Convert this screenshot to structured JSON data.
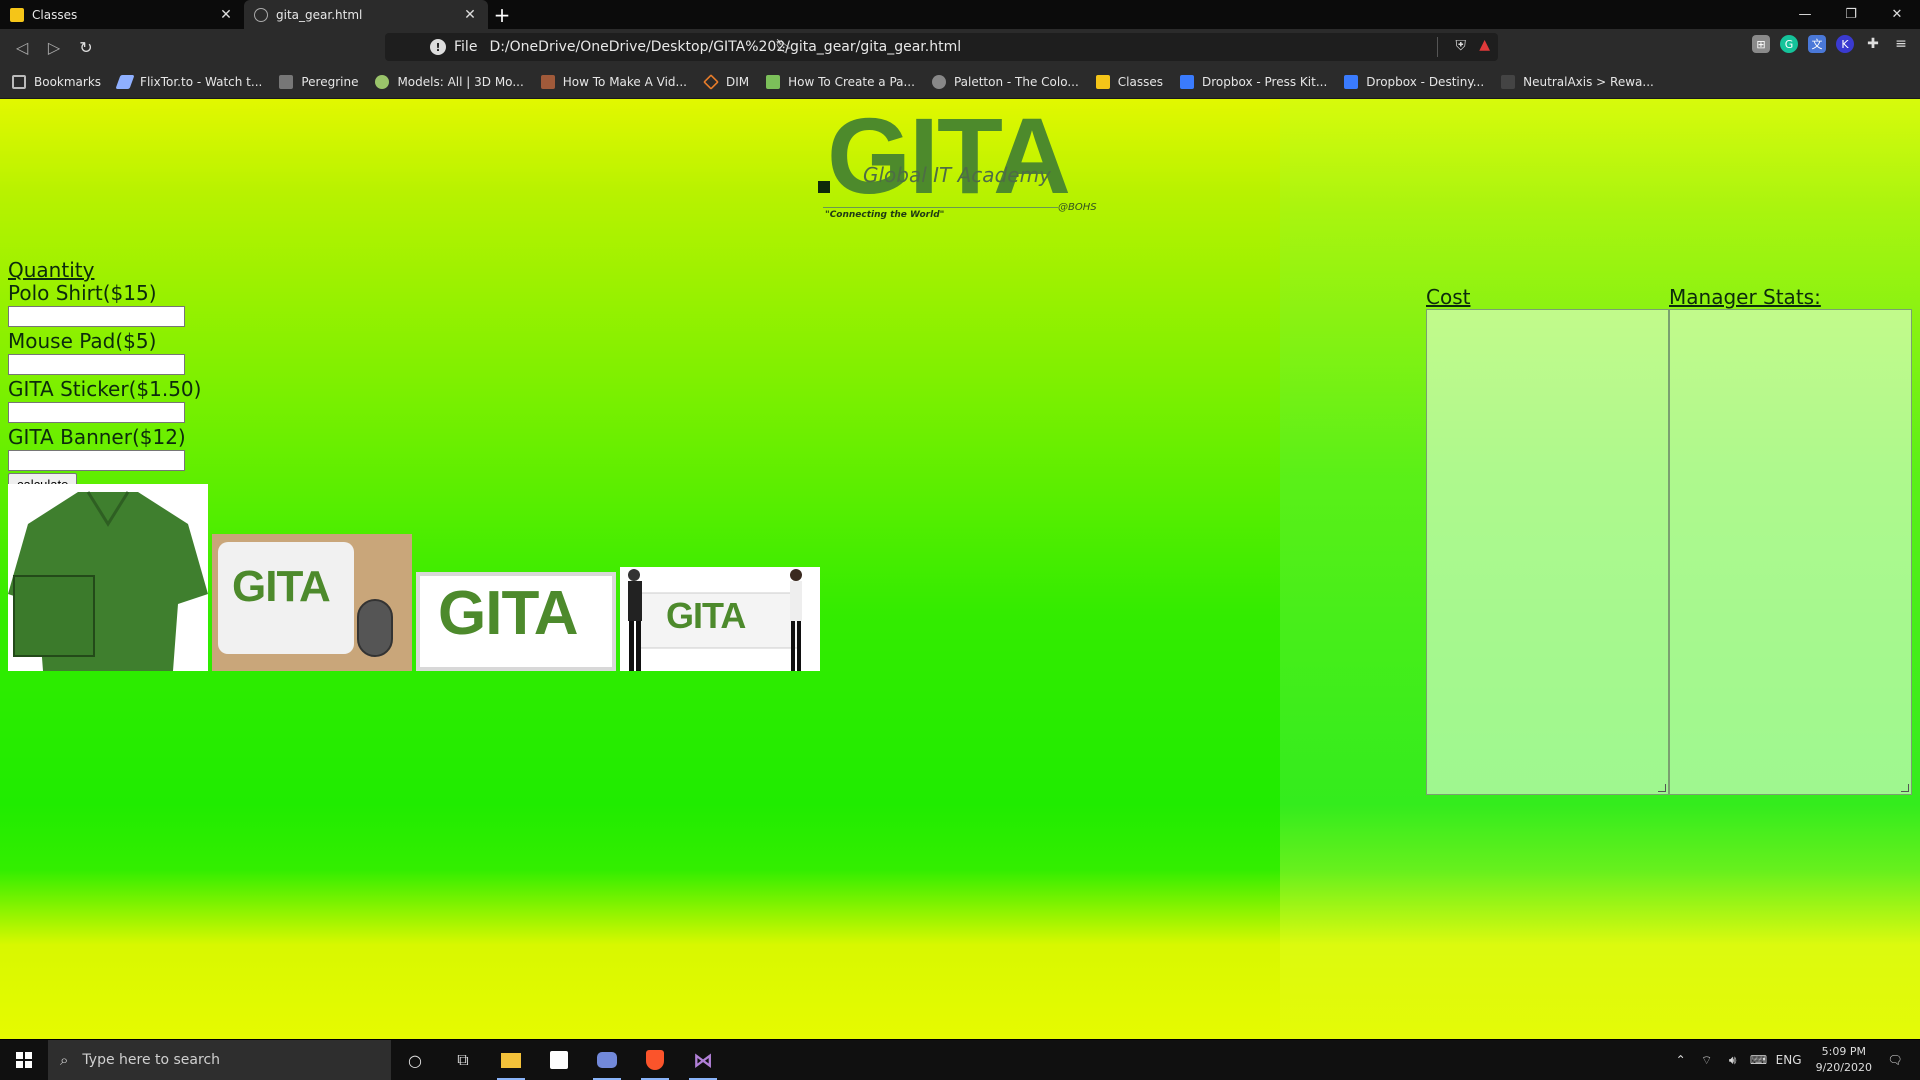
{
  "browser": {
    "tabs": [
      {
        "label": "Classes",
        "active": false
      },
      {
        "label": "gita_gear.html",
        "active": true
      }
    ],
    "address": {
      "protocol": "File",
      "url": "D:/OneDrive/OneDrive/Desktop/GITA%202/gita_gear/gita_gear.html"
    },
    "bookmarks": [
      {
        "label": "Bookmarks",
        "icon": "bookmarks-folder-icon",
        "color": "#bbbbbb"
      },
      {
        "label": "FlixTor.to - Watch t...",
        "icon": "flixtor-icon",
        "color": "#8fb0ff"
      },
      {
        "label": "Peregrine",
        "icon": "peregrine-icon",
        "color": "#777777"
      },
      {
        "label": "Models: All | 3D Mo...",
        "icon": "models-icon",
        "color": "#9ac46a"
      },
      {
        "label": "How To Make A Vid...",
        "icon": "video-icon",
        "color": "#a05a3a"
      },
      {
        "label": "DIM",
        "icon": "dim-icon",
        "color": "#e87d2a"
      },
      {
        "label": "How To Create a Pa...",
        "icon": "pattern-icon",
        "color": "#7cc05a"
      },
      {
        "label": "Paletton - The Colo...",
        "icon": "paletton-icon",
        "color": "#888888"
      },
      {
        "label": "Classes",
        "icon": "classroom-icon",
        "color": "#f5c518"
      },
      {
        "label": "Dropbox - Press Kit...",
        "icon": "dropbox-icon",
        "color": "#3a7bfd"
      },
      {
        "label": "Dropbox - Destiny...",
        "icon": "dropbox-icon",
        "color": "#3a7bfd"
      },
      {
        "label": "NeutralAxis > Rewa...",
        "icon": "neutralaxis-icon",
        "color": "#444444"
      }
    ]
  },
  "page": {
    "logo": {
      "wordmark": "GITA",
      "subtitle": "Global IT Academy",
      "tagline": "\"Connecting the World\"",
      "org": "@BOHS"
    },
    "form": {
      "quantity_heading": "Quantity",
      "items": [
        {
          "label": "Polo Shirt($15)",
          "value": ""
        },
        {
          "label": "Mouse Pad($5)",
          "value": ""
        },
        {
          "label": "GITA Sticker($1.50)",
          "value": ""
        },
        {
          "label": "GITA Banner($12)",
          "value": ""
        }
      ],
      "calculate_label": "calculate"
    },
    "output": {
      "cost_label": "Cost",
      "stats_label": "Manager Stats:",
      "cost_value": "",
      "stats_value": ""
    },
    "colors": {
      "brand_green": "#4d8a2c",
      "bg_lime": "#e2f800",
      "bg_green": "#20ec00"
    }
  },
  "taskbar": {
    "search_placeholder": "Type here to search",
    "language": "ENG",
    "time": "5:09 PM",
    "date": "9/20/2020"
  }
}
